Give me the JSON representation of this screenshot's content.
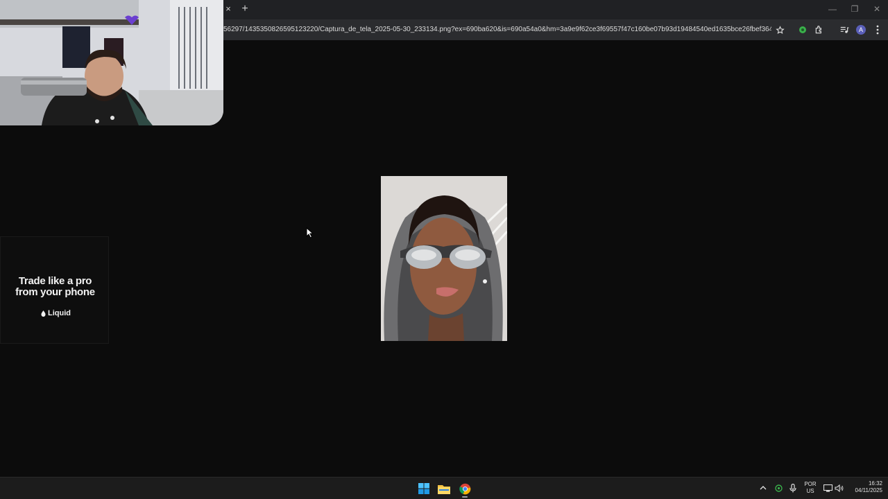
{
  "browser": {
    "tab_close_glyph": "×",
    "new_tab_glyph": "+",
    "url": "56297/1435350826595123220/Captura_de_tela_2025-05-30_233134.png?ex=690ba620&is=690a54a0&hm=3a9e9f62ce3f69557f47c160be07b93d19484540ed1635bce26fbef3643fe7b9&=&f...",
    "profile_initial": "A",
    "window_controls": {
      "minimize": "—",
      "maximize": "❐",
      "close": "✕"
    },
    "icons": [
      "star-icon",
      "extension-status-icon",
      "puzzle-icon",
      "media-controls-icon",
      "profile-avatar",
      "menu-icon"
    ]
  },
  "webcam": {
    "description_icon": "webcam-overlay"
  },
  "ad": {
    "headline_line1": "Trade like a pro",
    "headline_line2": "from your phone",
    "brand": "Liquid"
  },
  "photo": {
    "icon": "portrait-photo"
  },
  "taskbar": {
    "apps": [
      "windows-start-icon",
      "file-explorer-icon",
      "chrome-icon"
    ],
    "language_line1": "POR",
    "language_line2": "US",
    "time": "16:32",
    "date": "04/11/2025"
  },
  "colors": {
    "page_bg": "#0c0c0c",
    "tabstrip": "#202124",
    "toolbar": "#2b2c2f",
    "taskbar": "#1c1c1c",
    "accent_green": "#3ab14b"
  }
}
